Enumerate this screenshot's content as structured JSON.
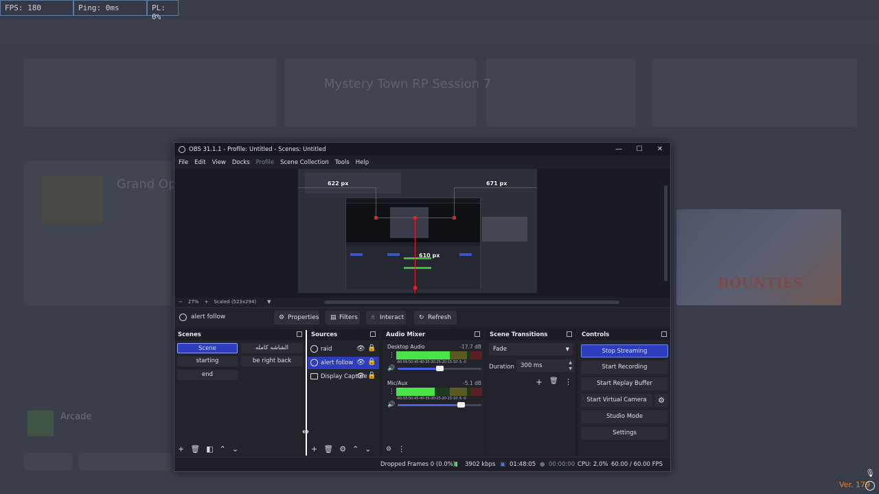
{
  "perf": {
    "fps": "FPS: 180",
    "ping": "Ping: 0ms",
    "pl": "PL: 0%"
  },
  "background": {
    "title_left": "Mystery Town RP Session 7",
    "grand": "Grand Op",
    "bounties": "BOUNTIES",
    "bottom_name": "Arcade"
  },
  "version": "Ver. 179",
  "obs": {
    "title": "OBS 31.1.1 - Profile: Untitled - Scenes: Untitled",
    "menu": [
      {
        "label": "File",
        "dim": false
      },
      {
        "label": "Edit",
        "dim": false
      },
      {
        "label": "View",
        "dim": false
      },
      {
        "label": "Docks",
        "dim": false
      },
      {
        "label": "Profile",
        "dim": true
      },
      {
        "label": "Scene Collection",
        "dim": false
      },
      {
        "label": "Tools",
        "dim": false
      },
      {
        "label": "Help",
        "dim": false
      }
    ],
    "preview": {
      "guide_left": "622 px",
      "guide_right": "671 px",
      "guide_bottom": "610 px",
      "zoom_minus": "−",
      "zoom": "27%",
      "zoom_plus": "+",
      "scale_mode": "Scaled (523x294)"
    },
    "source_toolbar": {
      "selected_source": "alert follow",
      "properties": "Properties",
      "filters": "Filters",
      "interact": "Interact",
      "refresh": "Refresh"
    },
    "scenes": {
      "title": "Scenes",
      "items": [
        {
          "label": "Scene",
          "active": true
        },
        {
          "label": "الشاشه كامله",
          "active": false
        },
        {
          "label": "starting",
          "active": false
        },
        {
          "label": "be right back",
          "active": false
        },
        {
          "label": "end",
          "active": false
        }
      ]
    },
    "sources": {
      "title": "Sources",
      "items": [
        {
          "label": "raid",
          "type": "browser"
        },
        {
          "label": "alert follow",
          "type": "browser"
        },
        {
          "label": "Display Capture",
          "type": "display"
        }
      ]
    },
    "mixer": {
      "title": "Audio Mixer",
      "ticks": "-60-55-50-45-40-35-30-25-20-15-10 -5 -0",
      "channels": [
        {
          "name": "Desktop Audio",
          "db": "-17.7 dB",
          "level": 0.62,
          "volume": 0.5
        },
        {
          "name": "Mic/Aux",
          "db": "-5.1 dB",
          "level": 0.45,
          "volume": 0.75
        }
      ]
    },
    "transitions": {
      "title": "Scene Transitions",
      "selected": "Fade",
      "duration_label": "Duration",
      "duration_value": "300 ms"
    },
    "controls": {
      "title": "Controls",
      "stop_streaming": "Stop Streaming",
      "start_recording": "Start Recording",
      "start_replay_buffer": "Start Replay Buffer",
      "start_virtual_camera": "Start Virtual Camera",
      "studio_mode": "Studio Mode",
      "settings": "Settings"
    },
    "status": {
      "dropped_frames": "Dropped Frames 0 (0.0%)",
      "bitrate": "3902 kbps",
      "stream_time": "01:48:05",
      "rec_time": "00:00:00",
      "cpu": "CPU: 2.0%",
      "fps": "60.00 / 60.00 FPS"
    }
  }
}
